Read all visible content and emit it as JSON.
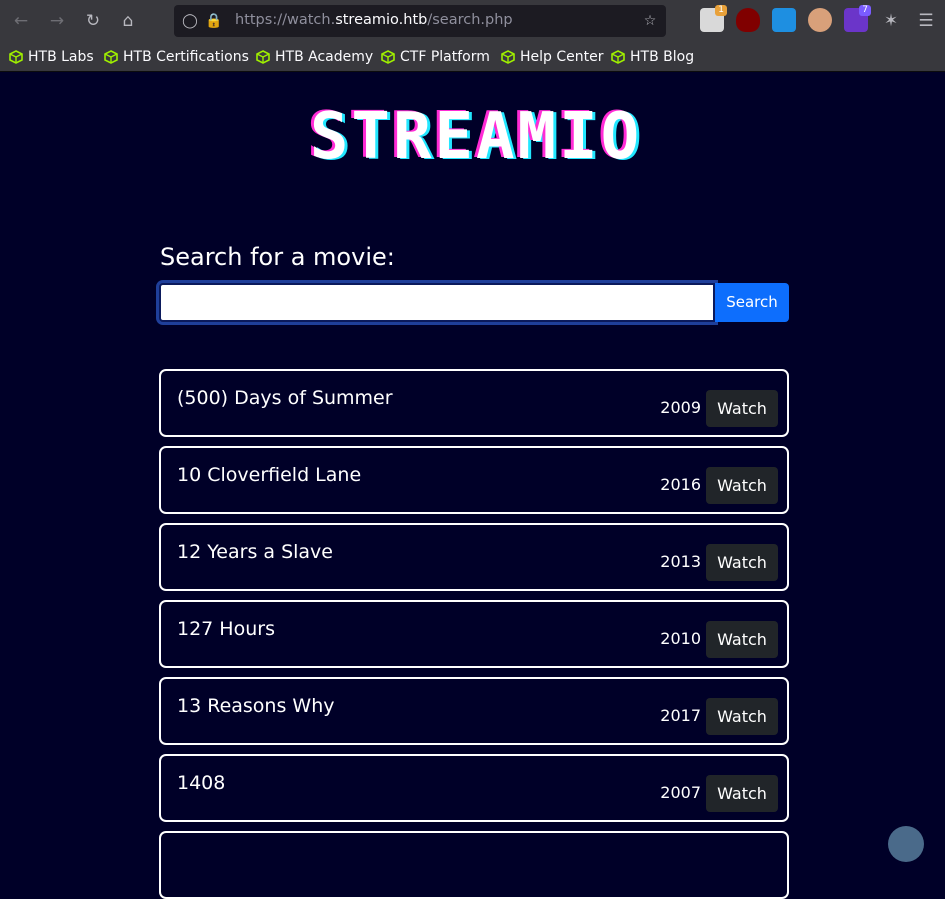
{
  "browser": {
    "url_prefix": "https://watch.",
    "url_host": "streamio.htb",
    "url_path": "/search.php",
    "bookmarks": [
      "HTB Labs",
      "HTB Certifications",
      "HTB Academy",
      "CTF Platform",
      "Help Center",
      "HTB Blog"
    ],
    "extension_badges": {
      "first": "1",
      "seventh": "7"
    }
  },
  "logo": {
    "text": "STREAMIO"
  },
  "search": {
    "heading": "Search for a movie:",
    "value": "",
    "button_label": "Search"
  },
  "movies": [
    {
      "title": "(500) Days of Summer",
      "year": "2009",
      "action": "Watch"
    },
    {
      "title": "10 Cloverfield Lane",
      "year": "2016",
      "action": "Watch"
    },
    {
      "title": "12 Years a Slave",
      "year": "2013",
      "action": "Watch"
    },
    {
      "title": "127 Hours",
      "year": "2010",
      "action": "Watch"
    },
    {
      "title": "13 Reasons Why",
      "year": "2017",
      "action": "Watch"
    },
    {
      "title": "1408",
      "year": "2007",
      "action": "Watch"
    }
  ],
  "colors": {
    "background": "#000028",
    "accent": "#0d6efd",
    "logo_pink": "#ff2bd6",
    "logo_cyan": "#22e7ff"
  }
}
